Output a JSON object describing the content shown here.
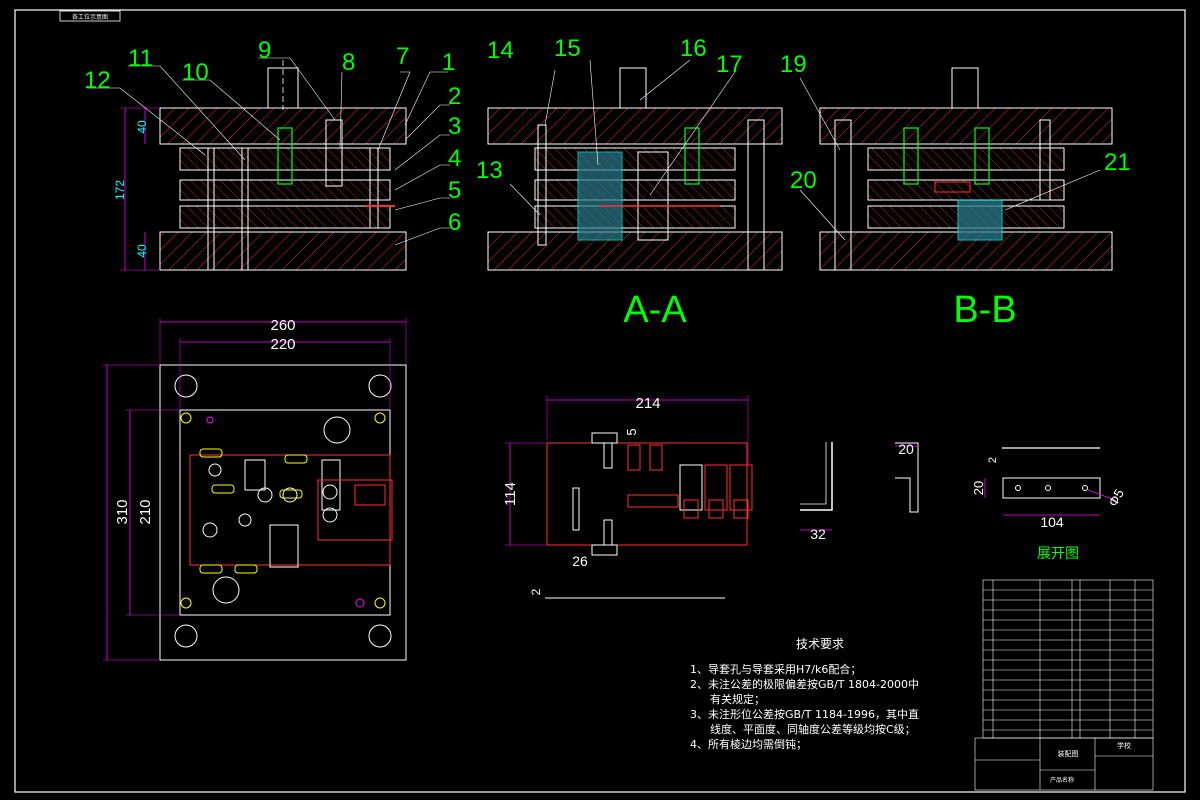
{
  "corner_tag": "各工位示意图",
  "part_numbers": [
    "1",
    "2",
    "3",
    "4",
    "5",
    "6",
    "7",
    "8",
    "9",
    "10",
    "11",
    "12",
    "13",
    "14",
    "15",
    "16",
    "17",
    "19",
    "20",
    "21"
  ],
  "section_labels": {
    "aa": "A-A",
    "bb": "B-B"
  },
  "dimensions": {
    "front_height": "172",
    "top_plate": "40",
    "bottom_plate": "40",
    "plan_width_outer": "260",
    "plan_width_inner": "220",
    "plan_height_outer": "310",
    "plan_height_inner": "210",
    "strip_width": "214",
    "strip_height": "114",
    "strip_5": "5",
    "strip_26": "26",
    "bend_32": "32",
    "bend_20": "20",
    "unfold_20": "20",
    "unfold_2": "2",
    "unfold_104": "104",
    "unfold_hole": "Φ5",
    "strip_thick": "2"
  },
  "unfold_title": "展开图",
  "tech": {
    "title": "技术要求",
    "items": [
      "1、导套孔与导套采用H7/k6配合；",
      "2、未注公差的极限偏差按GB/T 1804-2000中",
      "有关规定；",
      "3、未注形位公差按GB/T 1184-1996，其中直",
      "线度、平面度、同轴度公差等级均按C级；",
      "4、所有棱边均需倒钝；"
    ]
  },
  "title_block": {
    "drawing_name": "装配图",
    "company": "学校",
    "scale_label": "产品名称"
  },
  "colors": {
    "bg": "#000000",
    "outline": "#ffffff",
    "hatch": "#ff3030",
    "dim": "#ff00ff",
    "dimtext": "#00ffff",
    "leader": "#00ff00",
    "part": "#ffff00"
  }
}
